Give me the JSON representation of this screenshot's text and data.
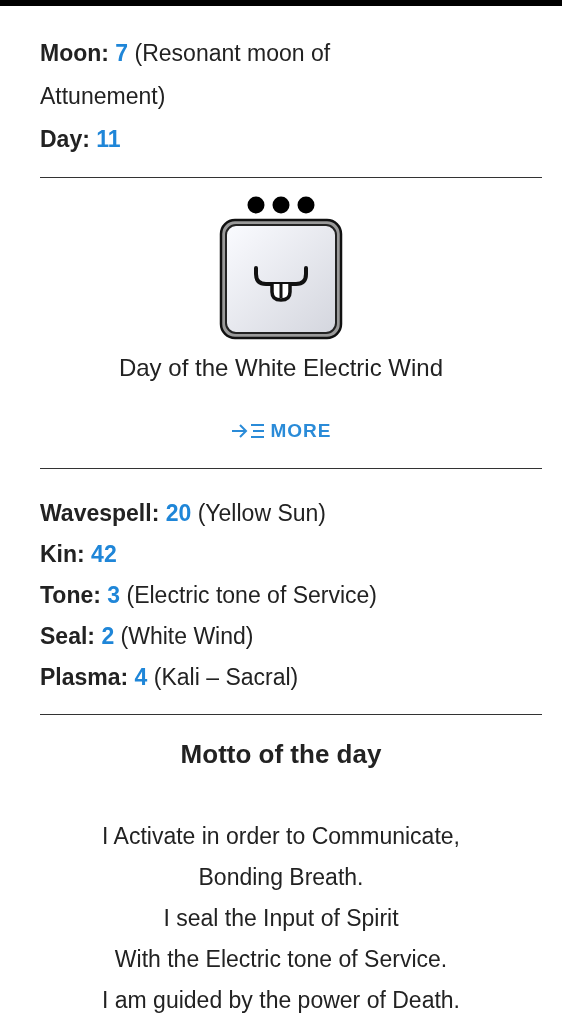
{
  "date_lines": [
    {
      "label": "Moon:",
      "value": "7",
      "note": "(Resonant moon of Attunement)"
    },
    {
      "label": "Day:",
      "value": "11"
    }
  ],
  "day": {
    "title": "Day of the White Electric Wind",
    "more_button": "MORE"
  },
  "details": [
    {
      "label": "Wavespell:",
      "value": "20",
      "note": "(Yellow Sun)"
    },
    {
      "label": "Kin:",
      "value": "42"
    },
    {
      "label": "Tone:",
      "value": "3",
      "note": "(Electric tone of Service)"
    },
    {
      "label": "Seal:",
      "value": "2",
      "note": "(White Wind)"
    },
    {
      "label": "Plasma:",
      "value": "4",
      "note": "(Kali – Sacral)"
    }
  ],
  "motto": {
    "title": "Motto of the day",
    "lines": [
      "I Activate in order to Communicate,",
      "Bonding Breath.",
      "I seal the Input of Spirit",
      "With the Electric tone of Service.",
      "I am guided by the power of Death."
    ]
  }
}
